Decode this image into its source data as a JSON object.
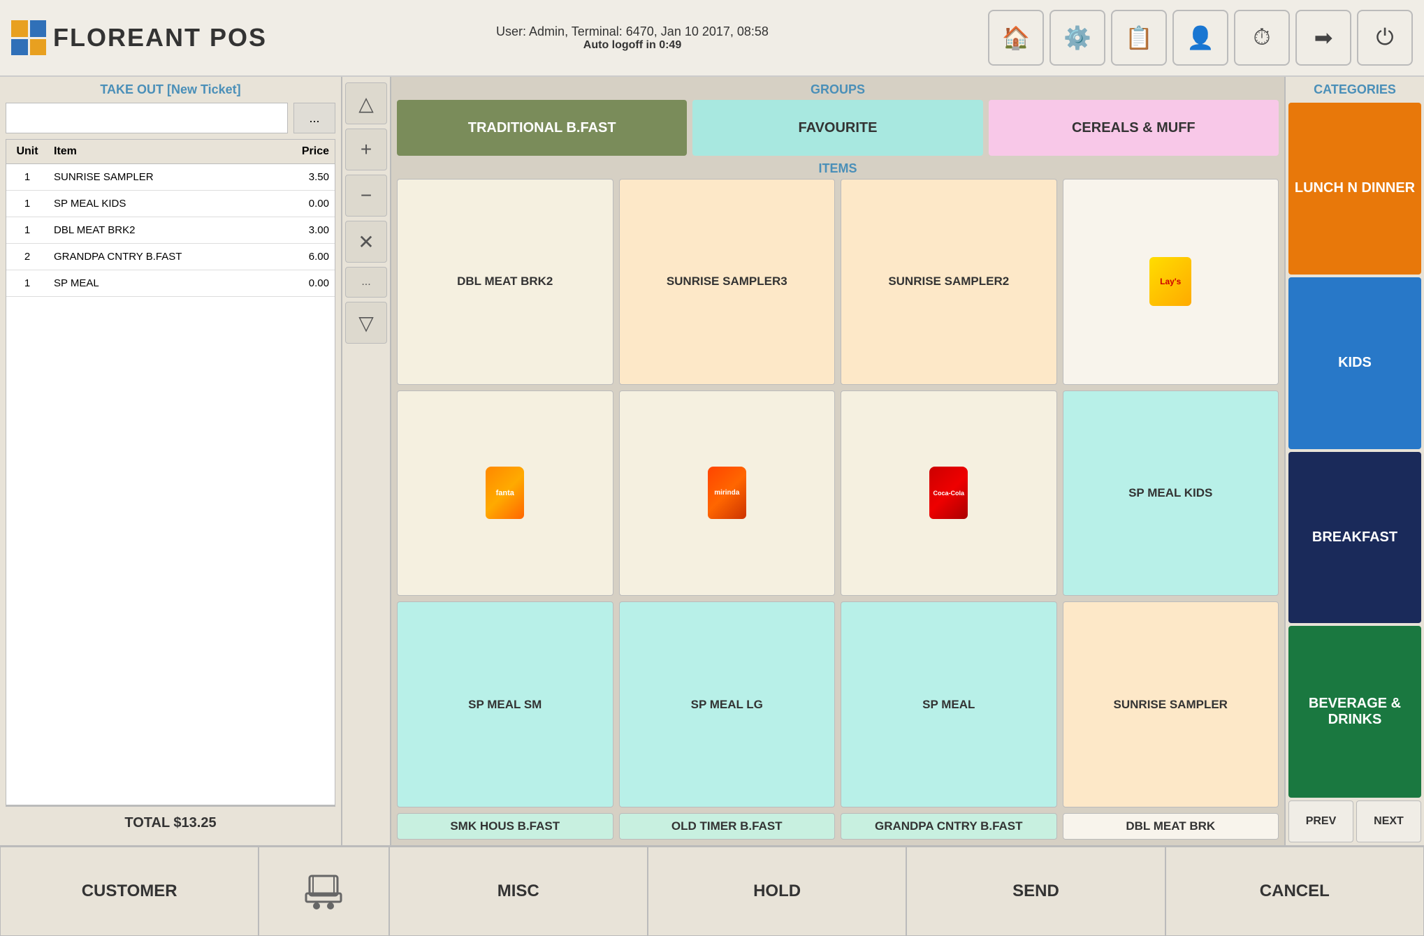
{
  "header": {
    "logo_text": "FLOREANT POS",
    "user_info": "User: Admin, Terminal: 6470, Jan 10 2017, 08:58",
    "autologoff": "Auto logoff in 0:49",
    "buttons": [
      {
        "name": "home",
        "icon": "🏠"
      },
      {
        "name": "tools",
        "icon": "🔧"
      },
      {
        "name": "orders",
        "icon": "📋"
      },
      {
        "name": "user-settings",
        "icon": "👤"
      },
      {
        "name": "timer",
        "icon": "⏱"
      },
      {
        "name": "transfer",
        "icon": "➡"
      },
      {
        "name": "power",
        "icon": "⏻"
      }
    ]
  },
  "left_panel": {
    "title": "TAKE OUT [New Ticket]",
    "dots_btn": "...",
    "table": {
      "headers": [
        "Unit",
        "Item",
        "Price"
      ],
      "rows": [
        {
          "unit": "1",
          "item": "SUNRISE SAMPLER",
          "price": "3.50"
        },
        {
          "unit": "1",
          "item": "SP MEAL KIDS",
          "price": "0.00"
        },
        {
          "unit": "1",
          "item": "DBL MEAT BRK2",
          "price": "3.00"
        },
        {
          "unit": "2",
          "item": "GRANDPA CNTRY B.FAST",
          "price": "6.00"
        },
        {
          "unit": "1",
          "item": "SP MEAL",
          "price": "0.00"
        }
      ]
    },
    "total_label": "TOTAL $13.25"
  },
  "order_controls": {
    "up_arrow": "△",
    "add": "+",
    "subtract": "−",
    "delete": "✕",
    "dots": "...",
    "down_arrow": "▽"
  },
  "groups": {
    "label": "GROUPS",
    "items": [
      {
        "label": "TRADITIONAL B.FAST",
        "style": "active-group"
      },
      {
        "label": "FAVOURITE",
        "style": "teal-group"
      },
      {
        "label": "CEREALS & MUFF",
        "style": "pink-group"
      }
    ]
  },
  "items": {
    "label": "ITEMS",
    "grid": [
      {
        "label": "DBL MEAT BRK2",
        "style": "cream",
        "type": "text"
      },
      {
        "label": "SUNRISE SAMPLER3",
        "style": "peach",
        "type": "text"
      },
      {
        "label": "SUNRISE SAMPLER2",
        "style": "peach",
        "type": "text"
      },
      {
        "label": "CHIPS",
        "style": "white-cream",
        "type": "chips"
      },
      {
        "label": "FANTA",
        "style": "cream",
        "type": "fanta"
      },
      {
        "label": "MIRINDA",
        "style": "cream",
        "type": "mirinda"
      },
      {
        "label": "COCA COLA",
        "style": "cream",
        "type": "cola"
      },
      {
        "label": "SP MEAL KIDS",
        "style": "teal-light",
        "type": "text"
      },
      {
        "label": "SP MEAL SM",
        "style": "teal-light",
        "type": "text"
      },
      {
        "label": "SP MEAL LG",
        "style": "teal-light",
        "type": "text"
      },
      {
        "label": "SP MEAL",
        "style": "teal-light",
        "type": "text"
      },
      {
        "label": "SUNRISE SAMPLER",
        "style": "peach",
        "type": "text"
      },
      {
        "label": "SMK HOUS B.FAST",
        "style": "mint",
        "type": "text"
      },
      {
        "label": "OLD TIMER B.FAST",
        "style": "mint",
        "type": "text"
      },
      {
        "label": "GRANDPA CNTRY B.FAST",
        "style": "mint",
        "type": "text"
      },
      {
        "label": "DBL MEAT BRK",
        "style": "white-cream",
        "type": "text"
      }
    ]
  },
  "categories": {
    "label": "CATEGORIES",
    "items": [
      {
        "label": "LUNCH N DINNER",
        "style": "orange"
      },
      {
        "label": "KIDS",
        "style": "blue"
      },
      {
        "label": "BREAKFAST",
        "style": "dark-blue"
      },
      {
        "label": "BEVERAGE & DRINKS",
        "style": "green"
      }
    ],
    "prev_label": "PREV",
    "next_label": "NEXT"
  },
  "bottom_bar": {
    "customer_label": "CUSTOMER",
    "misc_label": "MISC",
    "hold_label": "HOLD",
    "send_label": "SEND",
    "cancel_label": "CANCEL"
  }
}
